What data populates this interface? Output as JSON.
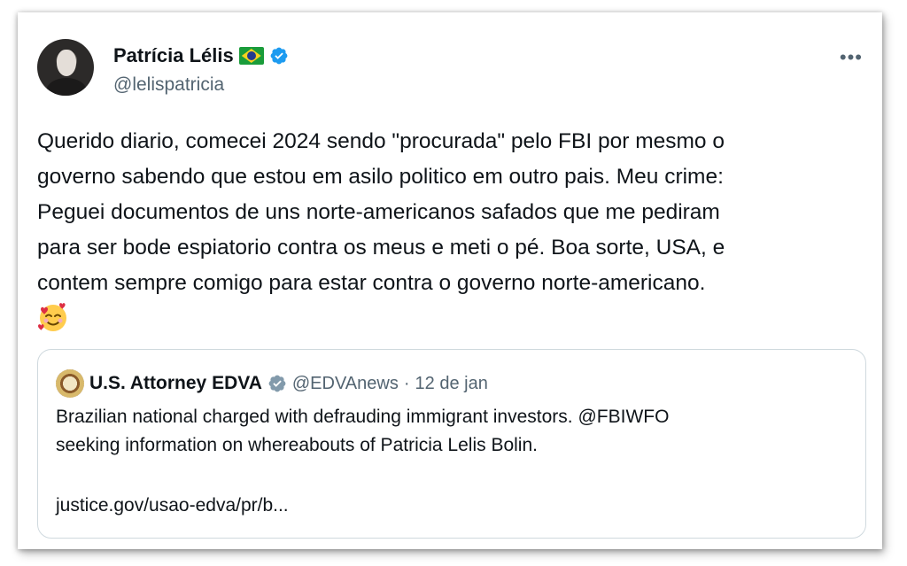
{
  "author": {
    "name": "Patrícia Lélis",
    "handle": "@lelispatricia"
  },
  "more_label": "•••",
  "tweet": {
    "lines": [
      "Querido diario, comecei 2024 sendo \"procurada\" pelo FBI por mesmo o",
      "governo sabendo que estou em asilo politico em outro pais. Meu crime:",
      "Peguei documentos de uns norte-americanos safados que me pediram",
      "para ser bode espiatorio contra os meus e meti o pé. Boa sorte, USA, e",
      "contem sempre comigo para estar contra o governo norte-americano."
    ],
    "emoji": "smiling-face-with-hearts"
  },
  "quoted": {
    "name": "U.S. Attorney EDVA",
    "handle": "@EDVAnews",
    "separator": "·",
    "date": "12 de jan",
    "lines": [
      "Brazilian national charged with defrauding immigrant investors. @FBIWFO",
      "seeking information on whereabouts of Patricia Lelis Bolin."
    ],
    "link": "justice.gov/usao-edva/pr/b..."
  },
  "colors": {
    "verified_blue": "#1d9bf0",
    "verified_gray": "#829aab",
    "text": "#0f1419",
    "secondary": "#536471",
    "border": "#cfd9de"
  }
}
